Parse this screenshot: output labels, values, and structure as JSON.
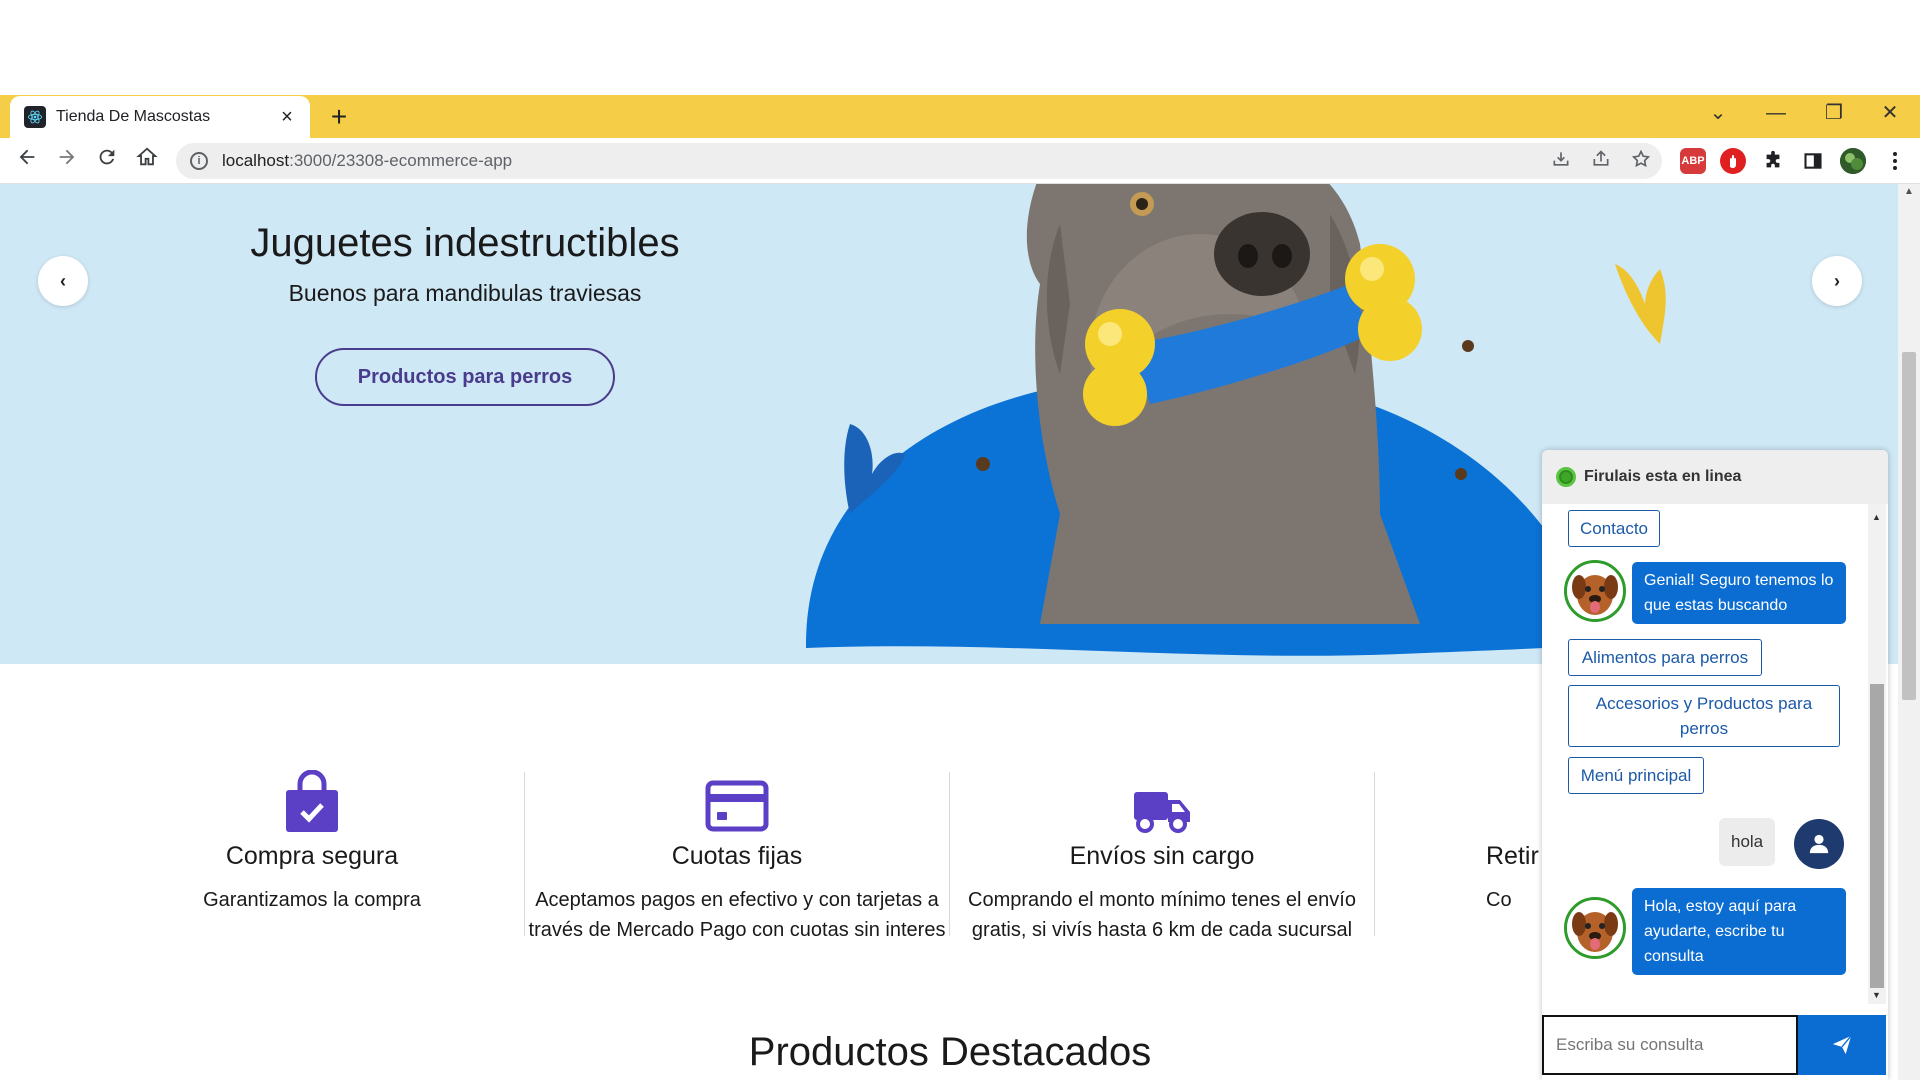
{
  "browser": {
    "tab_title": "Tienda De Mascostas",
    "new_tab": "+",
    "url_host": "localhost",
    "url_path": ":3000/23308-ecommerce-app",
    "controls": {
      "minimize": "—",
      "restore": "❐",
      "close": "✕",
      "dropdown": "⌄"
    },
    "extensions": {
      "abp": "ABP"
    }
  },
  "hero": {
    "title": "Juguetes indestructibles",
    "subtitle": "Buenos para mandibulas traviesas",
    "cta": "Productos para perros",
    "prev": "‹",
    "next": "›"
  },
  "features": [
    {
      "icon": "shopping-bag-check-icon",
      "title": "Compra segura",
      "text": "Garantizamos la compra"
    },
    {
      "icon": "credit-card-icon",
      "title": "Cuotas fijas",
      "text": "Aceptamos pagos en efectivo y con tarjetas a través de Mercado Pago con cuotas sin interes"
    },
    {
      "icon": "truck-icon",
      "title": "Envíos sin cargo",
      "text": "Comprando el monto mínimo tenes el envío gratis, si vivís hasta 6 km de cada sucursal"
    },
    {
      "icon": "store-icon",
      "title": "Retir",
      "text": "Co"
    }
  ],
  "section_title": "Productos Destacados",
  "chat": {
    "header": "Firulais esta en linea",
    "options_top": [
      "Contacto"
    ],
    "bot_msg_1": "Genial! Seguro tenemos lo que estas buscando",
    "options": [
      "Alimentos para perros",
      "Accesorios y Productos para perros",
      "Menú principal"
    ],
    "user_msg": "hola",
    "bot_msg_2": "Hola, estoy aquí para ayudarte, escribe tu consulta",
    "input_placeholder": "Escriba su consulta"
  },
  "colors": {
    "tab_strip": "#f6cd46",
    "hero_bg": "#cfe8f6",
    "hero_circle": "#0b72d6",
    "accent_purple": "#5b3fc4",
    "chat_blue": "#0b6dd1",
    "bot_border": "#2d9c2a"
  }
}
